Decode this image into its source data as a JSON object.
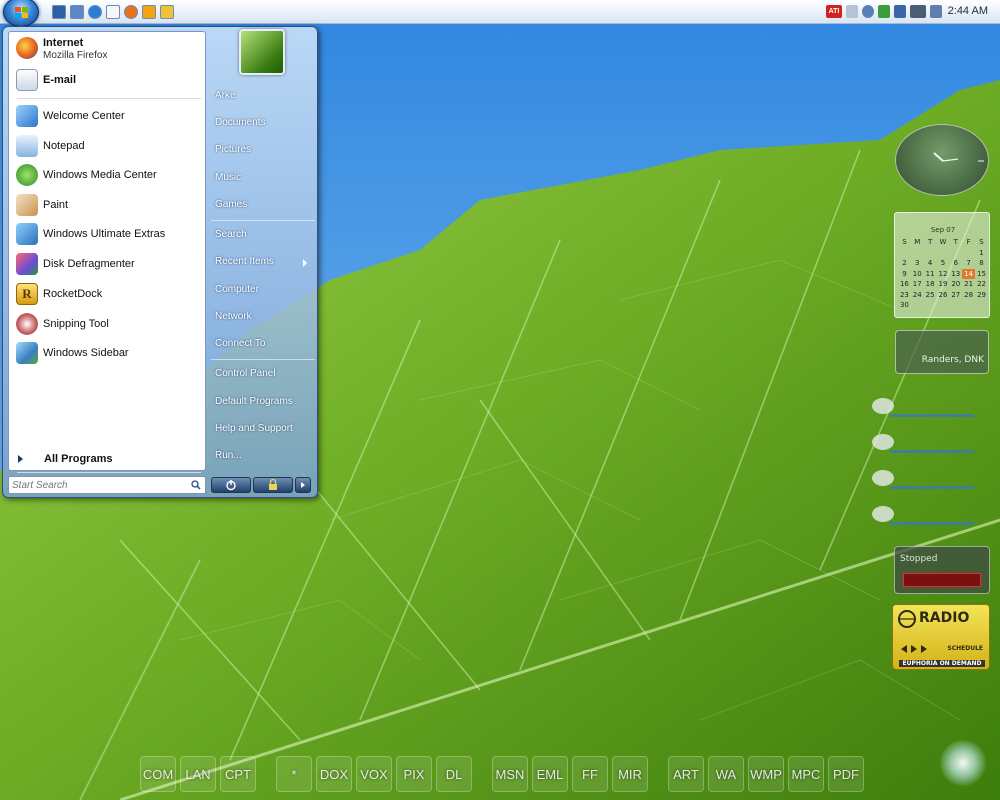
{
  "colors": {
    "taskbar": "#e8eef8",
    "start_orb": "#3a87d6",
    "leaf_green": "#6fb12a",
    "sky_blue": "#6cb4ef",
    "today_highlight": "#e07a2a"
  },
  "taskbar": {
    "start_icon": "windows-flag-icon",
    "quick_launch": [
      {
        "icon": "show-desktop-icon"
      },
      {
        "icon": "switch-windows-icon"
      },
      {
        "icon": "internet-explorer-icon"
      },
      {
        "icon": "mail-icon"
      },
      {
        "icon": "firefox-icon"
      },
      {
        "icon": "media-player-icon"
      },
      {
        "icon": "pencil-icon"
      }
    ],
    "tray": {
      "icons": [
        "ati-icon",
        "printer-icon",
        "user-icon",
        "shield-icon",
        "network-icon",
        "audio-3d-icon",
        "speaker-icon"
      ],
      "ati_label": "ATI",
      "time": "2:44 AM"
    }
  },
  "start_menu": {
    "pinned": [
      {
        "label": "Internet",
        "sub": "Mozilla Firefox",
        "icon": "firefox-icon"
      },
      {
        "label": "E-mail",
        "icon": "mail-icon"
      }
    ],
    "recent": [
      {
        "label": "Welcome Center",
        "icon": "welcome-center-icon"
      },
      {
        "label": "Notepad",
        "icon": "notepad-icon"
      },
      {
        "label": "Windows Media Center",
        "icon": "media-center-icon"
      },
      {
        "label": "Paint",
        "icon": "paint-icon"
      },
      {
        "label": "Windows Ultimate Extras",
        "icon": "ultimate-extras-icon"
      },
      {
        "label": "Disk Defragmenter",
        "icon": "defrag-icon"
      },
      {
        "label": "RocketDock",
        "icon": "rocketdock-icon"
      },
      {
        "label": "Snipping Tool",
        "icon": "scissors-icon"
      },
      {
        "label": "Windows Sidebar",
        "icon": "sidebar-icon"
      }
    ],
    "all_programs": "All Programs",
    "search_placeholder": "Start Search",
    "right_links": [
      {
        "label": "Arke"
      },
      {
        "label": "Documents"
      },
      {
        "label": "Pictures"
      },
      {
        "label": "Music"
      },
      {
        "label": "Games"
      },
      {
        "label": "Search"
      },
      {
        "label": "Recent Items"
      },
      {
        "label": "Computer"
      },
      {
        "label": "Network"
      },
      {
        "label": "Connect To"
      },
      {
        "label": "Control Panel"
      },
      {
        "label": "Default Programs"
      },
      {
        "label": "Help and Support"
      },
      {
        "label": "Run..."
      }
    ],
    "power_buttons": [
      "power-icon",
      "lock-icon",
      "chevron-right-icon"
    ]
  },
  "gadgets": {
    "calendar": {
      "month": "Sep 07",
      "weekdays": [
        "S",
        "M",
        "T",
        "W",
        "T",
        "F",
        "S"
      ],
      "weeks": [
        [
          "",
          "",
          "",
          "",
          "",
          "",
          "1"
        ],
        [
          "2",
          "3",
          "4",
          "5",
          "6",
          "7",
          "8"
        ],
        [
          "9",
          "10",
          "11",
          "12",
          "13",
          "14",
          "15"
        ],
        [
          "16",
          "17",
          "18",
          "19",
          "20",
          "21",
          "22"
        ],
        [
          "23",
          "24",
          "25",
          "26",
          "27",
          "28",
          "29"
        ],
        [
          "30",
          "",
          "",
          "",
          "",
          "",
          ""
        ]
      ],
      "today": "14"
    },
    "weather": {
      "city": "Randers, DNK"
    },
    "media": {
      "status": "Stopped"
    },
    "radio": {
      "title": "RADIO",
      "schedule": "SCHEDULE",
      "on_demand": "EUPHORIA ON DEMAND"
    }
  },
  "dock": {
    "items": [
      "COM",
      "LAN",
      "CPT",
      "*",
      "DOX",
      "VOX",
      "PIX",
      "DL",
      "MSN",
      "EML",
      "FF",
      "MIR",
      "ART",
      "WA",
      "WMP",
      "MPC",
      "PDF"
    ]
  }
}
